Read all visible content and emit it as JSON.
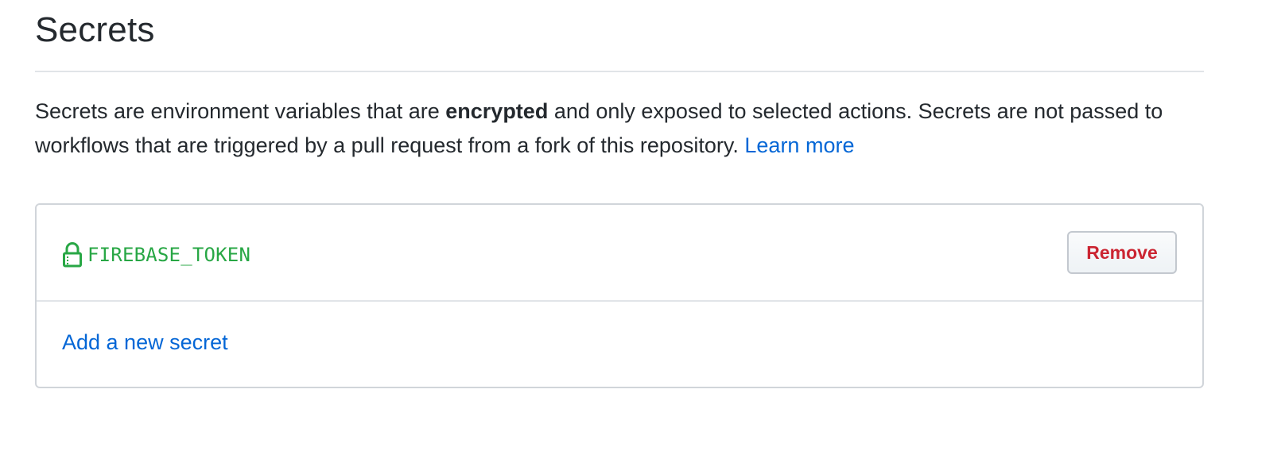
{
  "header": {
    "title": "Secrets"
  },
  "description": {
    "text_before": "Secrets are environment variables that are ",
    "bold_text": "encrypted",
    "text_after": " and only exposed to selected actions. Secrets are not passed to workflows that are triggered by a pull request from a fork of this repository. ",
    "learn_more_label": "Learn more"
  },
  "secrets": {
    "items": [
      {
        "name": "FIREBASE_TOKEN",
        "icon": "lock-icon",
        "remove_label": "Remove"
      }
    ],
    "add_label": "Add a new secret"
  },
  "colors": {
    "link": "#0366d6",
    "secret_name": "#28a745",
    "danger": "#cb2431",
    "text": "#24292e",
    "border": "#d1d5da"
  }
}
